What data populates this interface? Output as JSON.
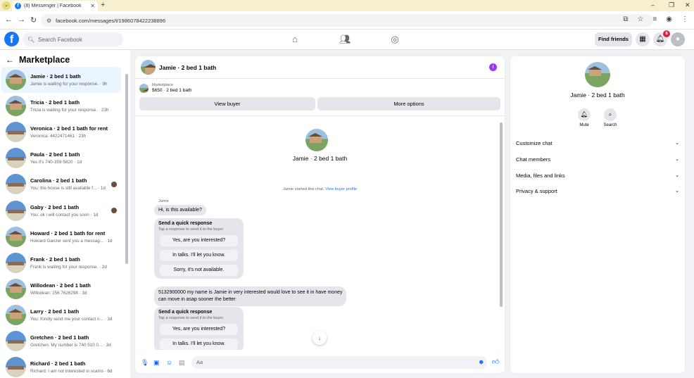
{
  "browser": {
    "tab_title": "(8) Messenger | Facebook",
    "url": "facebook.com/messages/t/1986078422238896"
  },
  "fb": {
    "search_placeholder": "Search Facebook",
    "find_friends": "Find friends",
    "notification_count": "8"
  },
  "sidebar": {
    "title": "Marketplace",
    "conversations": [
      {
        "name": "Jamie · 2 bed 1 bath",
        "preview": "Jamie is waiting for your response. · 9h",
        "avatar": "house"
      },
      {
        "name": "Tricia · 2 bed 1 bath",
        "preview": "Tricia is waiting for your response. · 23h",
        "avatar": "house"
      },
      {
        "name": "Veronica · 2 bed 1 bath for rent",
        "preview": "Veronica: 4422471461 · 23h",
        "avatar": "blue"
      },
      {
        "name": "Paula · 2 bed 1 bath",
        "preview": "Yes it's 740-359-5820 · 1d",
        "avatar": "blue"
      },
      {
        "name": "Carolina · 2 bed 1 bath",
        "preview": "You: the house is still available f... · 1d",
        "avatar": "blue"
      },
      {
        "name": "Gaby · 2 bed 1 bath",
        "preview": "You: ok i will contact you soon · 1d",
        "avatar": "blue"
      },
      {
        "name": "Howard · 2 bed 1 bath for rent",
        "preview": "Howard Ganzer sent you a messag... · 1d",
        "avatar": "house"
      },
      {
        "name": "Frank · 2 bed 1 bath",
        "preview": "Frank is waiting for your response. · 2d",
        "avatar": "blue"
      },
      {
        "name": "Willodean · 2 bed 1 bath",
        "preview": "Willodean: 256 7626298 · 3d",
        "avatar": "house"
      },
      {
        "name": "Larry · 2 bed 1 bath",
        "preview": "You: Kindly send me your contact n... · 3d",
        "avatar": "house"
      },
      {
        "name": "Gretchen · 2 bed 1 bath",
        "preview": "Gretchen: My number is 740 510 0... · 3d",
        "avatar": "blue"
      },
      {
        "name": "Richard · 2 bed 1 bath",
        "preview": "Richard: I am not interested in scams · 6d",
        "avatar": "blue"
      }
    ]
  },
  "chat": {
    "title": "Jamie · 2 bed 1 bath",
    "marketplace_label": "Marketplace",
    "listing": "$650 · 2 bed 1 bath",
    "view_buyer": "View buyer",
    "more_options": "More options",
    "profile_name": "Jamie · 2 bed 1 bath",
    "started_text": "Jamie started this chat.",
    "view_buyer_profile": "View buyer profile",
    "sender": "Jamie",
    "first_message": "Hi, is this available?",
    "quick_title": "Send a quick response",
    "quick_sub": "Tap a response to send it to the buyer.",
    "quick_options": [
      "Yes, are you interested?",
      "In talks. I'll let you know.",
      "Sorry, it's not available."
    ],
    "second_message_line1": "5132900000 my name is Jamie in very interested would love to see it in have money",
    "second_message_line2": "can move in asap sooner the better",
    "quick2_options": [
      "Yes, are you interested?",
      "In talks. I'll let you know."
    ],
    "composer_placeholder": "Aa"
  },
  "panel": {
    "name": "Jamie · 2 bed 1 bath",
    "mute": "Mute",
    "search": "Search",
    "items": [
      "Customize chat",
      "Chat members",
      "Media, files and links",
      "Privacy & support"
    ]
  }
}
